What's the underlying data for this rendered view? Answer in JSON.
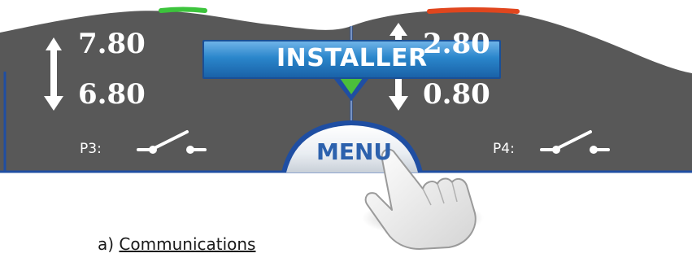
{
  "left_panel": {
    "setpoint_high": "7.80",
    "setpoint_low": "6.80",
    "port_label": "P3:",
    "indicator_color": "#3cc43c"
  },
  "right_panel": {
    "setpoint_high": "2.80",
    "setpoint_low": "0.80",
    "port_label": "P4:",
    "indicator_color": "#e0461e"
  },
  "installer_button": {
    "label": "INSTALLER",
    "color": "#1e74b8"
  },
  "menu_button": {
    "label": "MENU"
  },
  "icons": {
    "up": "arrow-up-icon",
    "down": "arrow-down-icon",
    "switch": "switch-open-icon",
    "pointer": "pointing-hand-icon"
  },
  "colors": {
    "panel_fill": "#5a5a5a",
    "panel_border": "#1f4ea2",
    "caption_text": "#1a1a1a"
  },
  "caption": {
    "prefix": "a)",
    "text": "Communications"
  }
}
